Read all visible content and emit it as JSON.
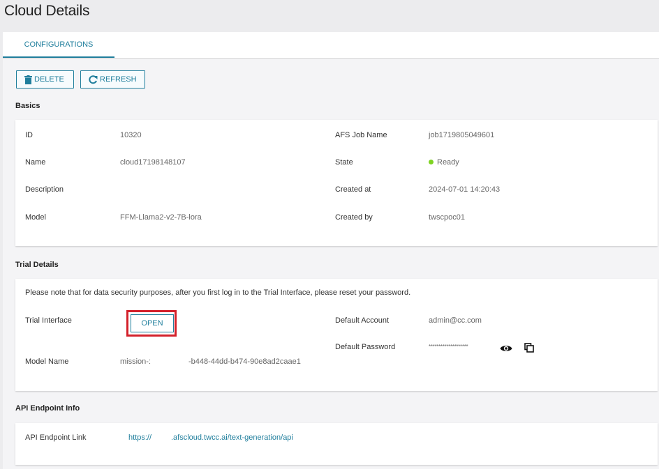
{
  "page": {
    "title": "Cloud Details"
  },
  "tabs": [
    {
      "label": "CONFIGURATIONS"
    }
  ],
  "toolbar": {
    "delete_label": "DELETE",
    "refresh_label": "REFRESH"
  },
  "basics": {
    "title": "Basics",
    "id_label": "ID",
    "id_value": "10320",
    "name_label": "Name",
    "name_value": "cloud17198148107",
    "description_label": "Description",
    "description_value": "",
    "model_label": "Model",
    "model_value": "FFM-Llama2-v2-7B-lora",
    "afs_job_label": "AFS Job Name",
    "afs_job_value": "job1719805049601",
    "state_label": "State",
    "state_value": "Ready",
    "state_color": "#7ed321",
    "created_at_label": "Created at",
    "created_at_value": "2024-07-01 14:20:43",
    "created_by_label": "Created by",
    "created_by_value": "twscpoc01"
  },
  "trial": {
    "title": "Trial Details",
    "notice": "Please note that for data security purposes, after you first log in to the Trial Interface, please reset your password.",
    "interface_label": "Trial Interface",
    "open_label": "OPEN",
    "model_name_label": "Model Name",
    "model_name_prefix": "mission-:",
    "model_name_suffix": "-b448-44dd-b474-90e8ad2caae1",
    "default_account_label": "Default Account",
    "default_account_value": "admin@cc.com",
    "default_password_label": "Default Password",
    "default_password_value": "********************",
    "show_password_icon": "eye-icon",
    "copy_icon": "copy-icon"
  },
  "api": {
    "title": "API Endpoint Info",
    "link_label": "API Endpoint Link",
    "link_prefix": "https://",
    "link_suffix": ".afscloud.twcc.ai/text-generation/api"
  },
  "colors": {
    "accent": "#1f7e9c",
    "highlight": "#d3202a",
    "ready": "#7ed321"
  }
}
